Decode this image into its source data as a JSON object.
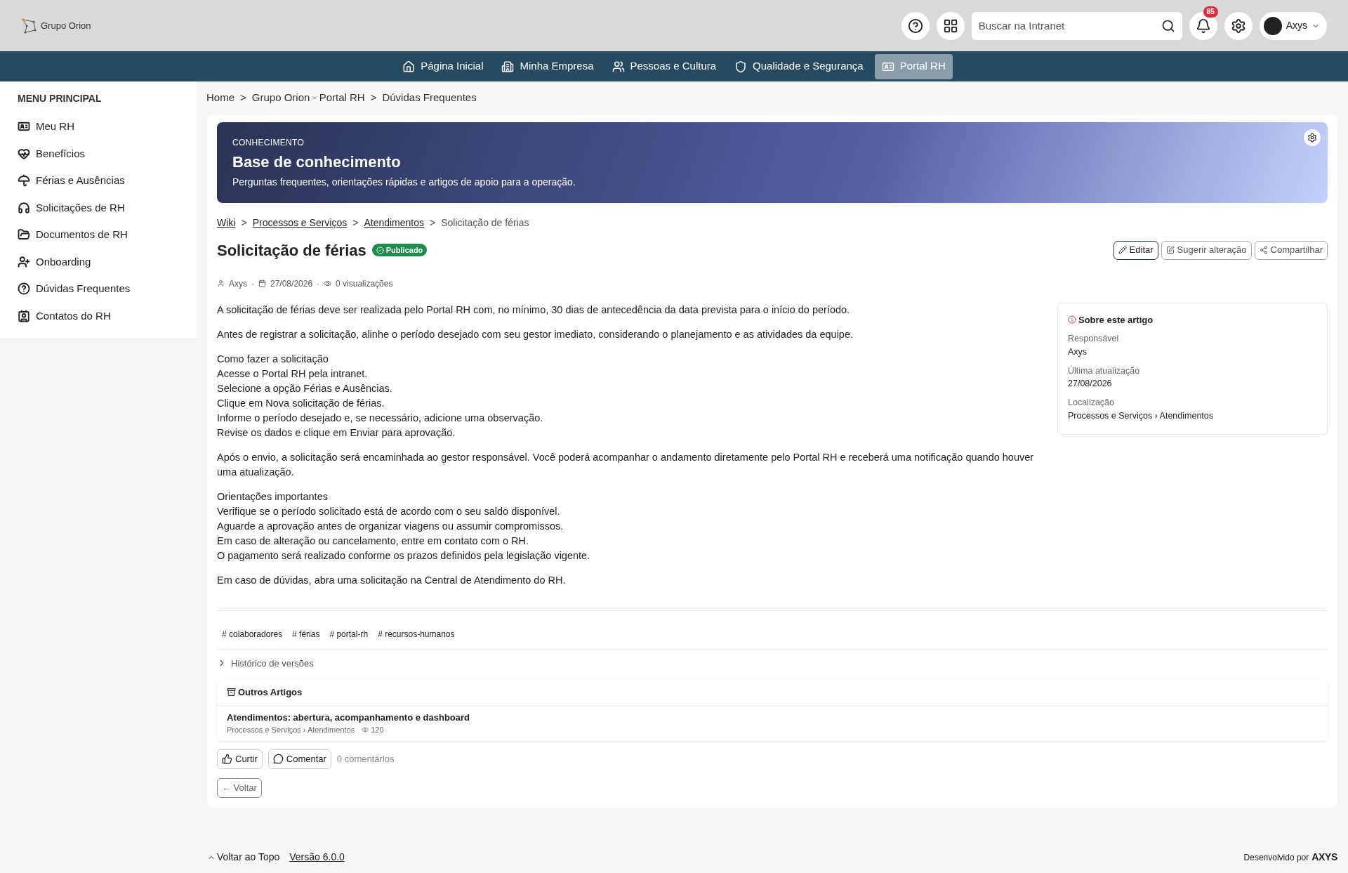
{
  "header": {
    "logo": "Grupo Orion",
    "search": {
      "placeholder": "Buscar na Intranet"
    },
    "notifications": "85",
    "user": "Axys"
  },
  "nav": [
    {
      "label": "Página Inicial",
      "selected": false
    },
    {
      "label": "Minha Empresa",
      "selected": false
    },
    {
      "label": "Pessoas e Cultura",
      "selected": false
    },
    {
      "label": "Qualidade e Segurança",
      "selected": false
    },
    {
      "label": "Portal RH",
      "selected": true
    }
  ],
  "sidebar": {
    "title": "MENU PRINCIPAL",
    "items": [
      {
        "label": "Meu RH"
      },
      {
        "label": "Benefícios"
      },
      {
        "label": "Férias e Ausências"
      },
      {
        "label": "Solicitações de RH"
      },
      {
        "label": "Documentos de RH"
      },
      {
        "label": "Onboarding"
      },
      {
        "label": "Dúvidas Frequentes"
      },
      {
        "label": "Contatos do RH"
      }
    ]
  },
  "breadcrumb": {
    "separator": ">",
    "items": [
      "Home",
      "Grupo Orion - Portal RH",
      "Dúvidas Frequentes"
    ]
  },
  "banner": {
    "eyebrow": "CONHECIMENTO",
    "title": "Base de conhecimento",
    "subtitle": "Perguntas frequentes, orientações rápidas e artigos de apoio para a operação."
  },
  "article": {
    "breadcrumb_separator": ">",
    "breadcrumb": [
      {
        "label": "Wiki",
        "kind": "link"
      },
      {
        "label": "Processos e Serviços",
        "kind": "link"
      },
      {
        "label": "Atendimentos",
        "kind": "link"
      },
      {
        "label": "Solicitação de férias",
        "kind": "current"
      }
    ],
    "title": "Solicitação de férias",
    "status": "Publicado",
    "actions": [
      {
        "label": "Editar",
        "kind": "primary"
      },
      {
        "label": "Sugerir alteração",
        "kind": "suggest"
      },
      {
        "label": "Compartilhar",
        "kind": "share"
      }
    ],
    "meta": {
      "separator": "·",
      "author": "Axys",
      "date": "27/08/2026",
      "views": "0 visualizações"
    },
    "body": [
      [
        "A solicitação de férias deve ser realizada pelo Portal RH com, no mínimo, 30 dias de antecedência da data prevista para o início do período."
      ],
      [
        "Antes de registrar a solicitação, alinhe o período desejado com seu gestor imediato, considerando o planejamento e as atividades da equipe."
      ],
      [
        "Como fazer a solicitação",
        "Acesse o Portal RH pela intranet.",
        "Selecione a opção Férias e Ausências.",
        "Clique em Nova solicitação de férias.",
        "Informe o período desejado e, se necessário, adicione uma observação.",
        "Revise os dados e clique em Enviar para aprovação."
      ],
      [
        "Após o envio, a solicitação será encaminhada ao gestor responsável. Você poderá acompanhar o andamento diretamente pelo Portal RH e receberá uma notificação quando houver uma atualização."
      ],
      [
        "Orientações importantes",
        "Verifique se o período solicitado está de acordo com o seu saldo disponível.",
        "Aguarde a aprovação antes de organizar viagens ou assumir compromissos.",
        "Em caso de alteração ou cancelamento, entre em contato com o RH.",
        "O pagamento será realizado conforme os prazos definidos pela legislação vigente."
      ],
      [
        "Em caso de dúvidas, abra uma solicitação na Central de Atendimento do RH."
      ]
    ],
    "info": {
      "title": "Sobre este artigo",
      "fields": [
        {
          "label": "Responsável",
          "value": "Axys"
        },
        {
          "label": "Última atualização",
          "value": "27/08/2026"
        },
        {
          "label": "Localização",
          "value": "Processos e Serviços › Atendimentos"
        }
      ]
    },
    "tags": [
      "# colaboradores",
      "# férias",
      "# portal-rh",
      "# recursos-humanos"
    ],
    "history": {
      "label": "Histórico de versões",
      "expanded": false
    },
    "other": {
      "title": "Outros Artigos",
      "items": [
        {
          "title": "Atendimentos: abertura, acompanhamento e dashboard",
          "path": "Processos e Serviços › Atendimentos",
          "views": "120"
        }
      ]
    },
    "reactions": {
      "like": "Curtir",
      "comment": "Comentar",
      "comments": "0 comentários"
    },
    "back": "← Voltar"
  },
  "footer": {
    "top": "Voltar ao Topo",
    "version": "Versão 6.0.0",
    "credit": "Desenvolvido por",
    "brand": "AXYS"
  }
}
